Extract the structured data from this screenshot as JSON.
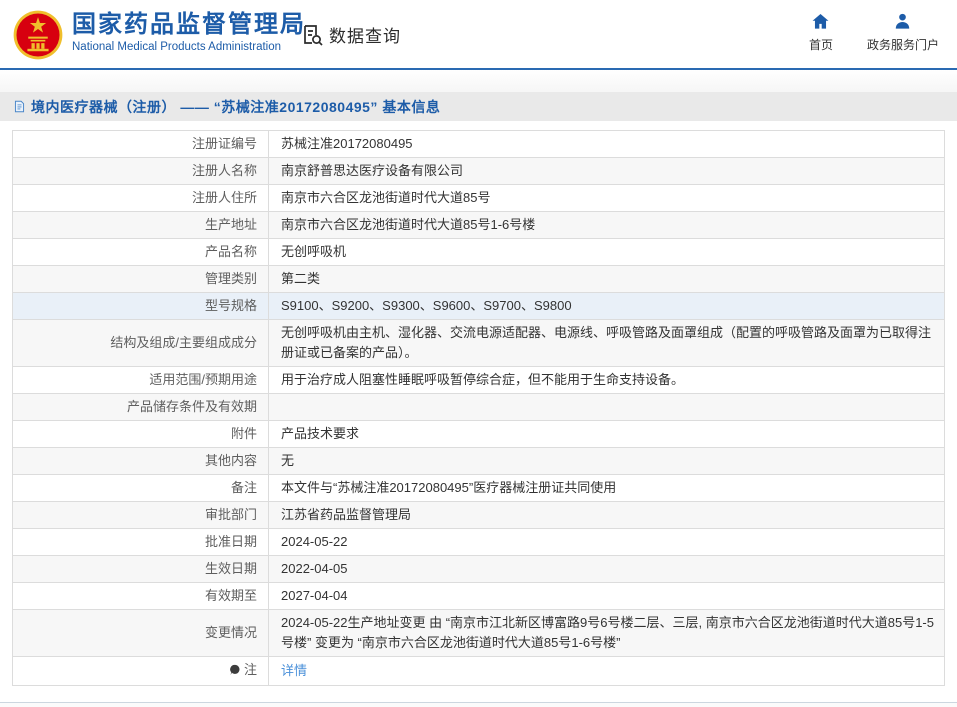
{
  "header": {
    "org_name": "国家药品监督管理局",
    "org_name_en": "National Medical Products Administration",
    "module_title": "数据查询",
    "nav": [
      {
        "label": "首页",
        "icon": "home-icon"
      },
      {
        "label": "政务服务门户",
        "icon": "user-icon"
      }
    ]
  },
  "breadcrumb": {
    "title": "境内医疗器械（注册） —— “苏械注准20172080495” 基本信息"
  },
  "table": {
    "rows": [
      {
        "label": "注册证编号",
        "value": "苏械注准20172080495"
      },
      {
        "label": "注册人名称",
        "value": "南京舒普思达医疗设备有限公司"
      },
      {
        "label": "注册人住所",
        "value": "南京市六合区龙池街道时代大道85号"
      },
      {
        "label": "生产地址",
        "value": "南京市六合区龙池街道时代大道85号1-6号楼"
      },
      {
        "label": "产品名称",
        "value": "无创呼吸机"
      },
      {
        "label": "管理类别",
        "value": "第二类"
      },
      {
        "label": "型号规格",
        "value": "S9100、S9200、S9300、S9600、S9700、S9800"
      },
      {
        "label": "结构及组成/主要组成成分",
        "value": "无创呼吸机由主机、湿化器、交流电源适配器、电源线、呼吸管路及面罩组成（配置的呼吸管路及面罩为已取得注册证或已备案的产品）。"
      },
      {
        "label": "适用范围/预期用途",
        "value": "用于治疗成人阻塞性睡眠呼吸暂停综合症，但不能用于生命支持设备。"
      },
      {
        "label": "产品储存条件及有效期",
        "value": ""
      },
      {
        "label": "附件",
        "value": "产品技术要求"
      },
      {
        "label": "其他内容",
        "value": "无"
      },
      {
        "label": "备注",
        "value": "本文件与“苏械注准20172080495”医疗器械注册证共同使用"
      },
      {
        "label": "审批部门",
        "value": "江苏省药品监督管理局"
      },
      {
        "label": "批准日期",
        "value": "2024-05-22"
      },
      {
        "label": "生效日期",
        "value": "2022-04-05"
      },
      {
        "label": "有效期至",
        "value": "2027-04-04"
      },
      {
        "label": "变更情况",
        "value": "2024-05-22生产地址变更 由 “南京市江北新区博富路9号6号楼二层、三层, 南京市六合区龙池街道时代大道85号1-5号楼” 变更为 “南京市六合区龙池街道时代大道85号1-6号楼”"
      },
      {
        "label": "注",
        "value": "详情"
      }
    ]
  },
  "icons": {
    "national-emblem": "red circle emblem with gold star",
    "data-query-icon": "document with magnifying glass",
    "home-icon": "solid house",
    "user-icon": "solid person",
    "document-icon": "small blue page",
    "note-icon": "dark speech balloon"
  },
  "colors": {
    "brand_blue": "#1d5ca8",
    "header_rule": "#2a6ab2",
    "breadcrumb_bg": "#e9e9e9",
    "stripe": "#f7f7f7",
    "hover_row": "#e9f0f8",
    "link_blue": "#4a90d9",
    "emblem_red": "#d7000f",
    "emblem_gold": "#f0bf2c"
  }
}
